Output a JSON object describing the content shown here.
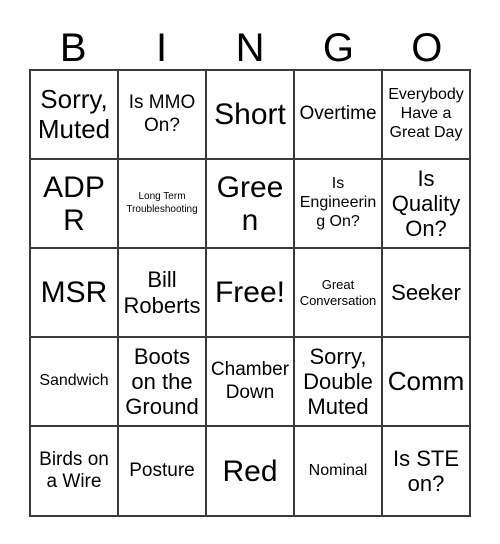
{
  "card": {
    "title": "BINGO",
    "header_letters": [
      "B",
      "I",
      "N",
      "G",
      "O"
    ],
    "free_space_label": "Free!",
    "colors": {
      "border": "#3a3a3a",
      "cell_background": "#ffffff",
      "text": "#000000",
      "page_background": "#ffffff"
    },
    "grid": {
      "columns": 5,
      "rows": 5,
      "cells": [
        [
          {
            "text": "Sorry, Muted",
            "size": "xl"
          },
          {
            "text": "Is MMO On?",
            "size": "m"
          },
          {
            "text": "Short",
            "size": "xxl"
          },
          {
            "text": "Overtime",
            "size": "m"
          },
          {
            "text": "Everybody Have a Great Day",
            "size": "s"
          }
        ],
        [
          {
            "text": "ADPR",
            "size": "xxl"
          },
          {
            "text": "Long Term Troubleshooting",
            "size": "xxs"
          },
          {
            "text": "Green",
            "size": "xxl"
          },
          {
            "text": "Is Engineering On?",
            "size": "s"
          },
          {
            "text": "Is Quality On?",
            "size": "l"
          }
        ],
        [
          {
            "text": "MSR",
            "size": "xxl"
          },
          {
            "text": "Bill Roberts",
            "size": "l"
          },
          {
            "text": "Free!",
            "size": "xxl"
          },
          {
            "text": "Great Conversation",
            "size": "xs"
          },
          {
            "text": "Seeker",
            "size": "l"
          }
        ],
        [
          {
            "text": "Sandwich",
            "size": "s"
          },
          {
            "text": "Boots on the Ground",
            "size": "l"
          },
          {
            "text": "Chamber Down",
            "size": "m"
          },
          {
            "text": "Sorry, Double Muted",
            "size": "l"
          },
          {
            "text": "Comm",
            "size": "xl"
          }
        ],
        [
          {
            "text": "Birds on a Wire",
            "size": "m"
          },
          {
            "text": "Posture",
            "size": "m"
          },
          {
            "text": "Red",
            "size": "xxl"
          },
          {
            "text": "Nominal",
            "size": "s"
          },
          {
            "text": "Is STE on?",
            "size": "l"
          }
        ]
      ]
    }
  }
}
